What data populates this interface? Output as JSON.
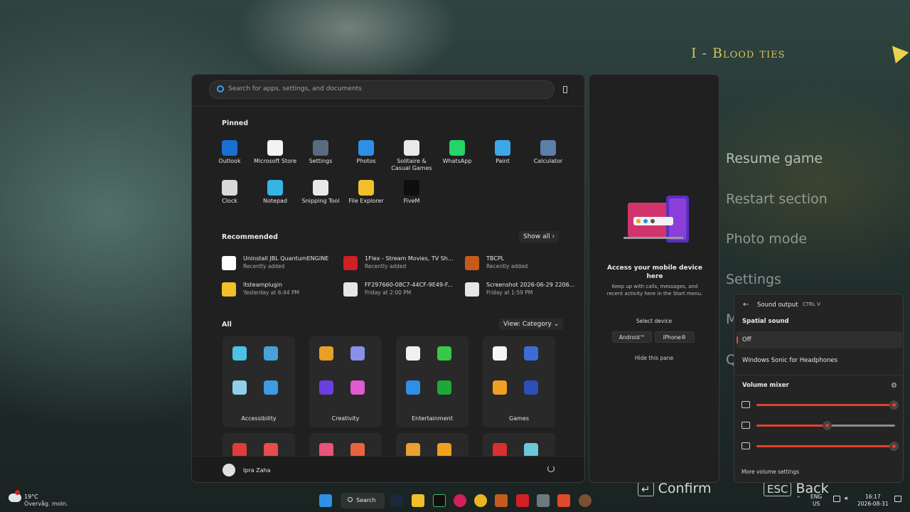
{
  "game": {
    "chapter_title": "I - Blood ties",
    "menu": [
      "Resume game",
      "Restart section",
      "Photo mode",
      "Settings",
      "M",
      "Q"
    ],
    "confirm_key": "↵",
    "confirm": "Confirm",
    "back_key": "ESC",
    "back": "Back"
  },
  "start": {
    "search_placeholder": "Search for apps, settings, and documents",
    "pinned_label": "Pinned",
    "pinned": [
      {
        "label": "Outlook",
        "icon": "outlook-icon",
        "color": "#1a6fd1"
      },
      {
        "label": "Microsoft Store",
        "icon": "store-icon",
        "color": "#f3f3f3"
      },
      {
        "label": "Settings",
        "icon": "settings-icon",
        "color": "#5a6a80"
      },
      {
        "label": "Photos",
        "icon": "photos-icon",
        "color": "#2f8fe6"
      },
      {
        "label": "Solitaire & Casual Games",
        "icon": "solitaire-icon",
        "color": "#e9e9e9"
      },
      {
        "label": "WhatsApp",
        "icon": "whatsapp-icon",
        "color": "#25d366"
      },
      {
        "label": "Paint",
        "icon": "paint-icon",
        "color": "#3ba7e8"
      },
      {
        "label": "Calculator",
        "icon": "calculator-icon",
        "color": "#5b7fa8"
      },
      {
        "label": "Clock",
        "icon": "clock-icon",
        "color": "#d9d9d9"
      },
      {
        "label": "Notepad",
        "icon": "notepad-icon",
        "color": "#35b5e6"
      },
      {
        "label": "Snipping Tool",
        "icon": "snipping-tool-icon",
        "color": "#e8e8e8"
      },
      {
        "label": "File Explorer",
        "icon": "folder-icon",
        "color": "#f2bf2a"
      },
      {
        "label": "FiveM",
        "icon": "fivem-icon",
        "color": "#0f0f0f"
      }
    ],
    "recommended_label": "Recommended",
    "show_all": "Show all  ›",
    "recommended": [
      {
        "title": "Uninstall JBL QuantumENGINE",
        "sub": "Recently added",
        "icon": "jbl-icon",
        "color": "#ffffff"
      },
      {
        "title": "1Flex - Stream Movies, TV Sh...",
        "sub": "Recently added",
        "icon": "1flex-icon",
        "color": "#d01f25"
      },
      {
        "title": "TBCPL",
        "sub": "Recently added",
        "icon": "tbcpl-icon",
        "color": "#c45b1d"
      },
      {
        "title": "ltsteamplugin",
        "sub": "Yesterday at 6:44 PM",
        "icon": "folder-icon",
        "color": "#f2bf2a"
      },
      {
        "title": "FF297660-08C7-44CF-9E49-F...",
        "sub": "Friday at 2:00 PM",
        "icon": "image-file-icon",
        "color": "#e6e6e6"
      },
      {
        "title": "Screenshot 2026-06-29 2206...",
        "sub": "Friday at 1:59 PM",
        "icon": "image-file-icon",
        "color": "#e6e6e6"
      }
    ],
    "all_label": "All",
    "view_label": "View: Category  ⌄",
    "categories": [
      {
        "name": "Accessibility",
        "colors": [
          "#4cc2e8",
          "#4aa0d8",
          "#8fd0e8",
          "#3d9be0"
        ]
      },
      {
        "name": "Creativity",
        "colors": [
          "#e8a028",
          "#8a8fe8",
          "#6a3fe0",
          "#e05ad0"
        ]
      },
      {
        "name": "Entertainment",
        "colors": [
          "#f0f0f0",
          "#37c84a",
          "#2f8fe6",
          "#1fa83a"
        ]
      },
      {
        "name": "Games",
        "colors": [
          "#f5f5f5",
          "#3d6bd6",
          "#f0a020",
          "#2c4fb8"
        ]
      },
      {
        "name": "",
        "colors": [
          "#e23b3b",
          "#e84b4b"
        ]
      },
      {
        "name": "",
        "colors": [
          "#e8557a",
          "#e8643f"
        ]
      },
      {
        "name": "",
        "colors": [
          "#e8a030",
          "#f0a020"
        ]
      },
      {
        "name": "",
        "colors": [
          "#d83030",
          "#6ac8d8"
        ]
      }
    ],
    "user_name": "Ipra Zaha"
  },
  "phone_pane": {
    "heading": "Access your mobile device here",
    "body": "Keep up with calls, messages, and recent activity here in the Start menu.",
    "select_label": "Select device",
    "android": "Android™",
    "iphone": "iPhone®",
    "hide": "Hide this pane"
  },
  "sound": {
    "back": "←",
    "title": "Sound output",
    "shortcut": "CTRL   V",
    "spatial_label": "Spatial sound",
    "off": "Off",
    "sonic": "Windows Sonic for Headphones",
    "mixer_label": "Volume mixer",
    "mixer": [
      {
        "icon": "monitor-icon",
        "value": 0.99
      },
      {
        "icon": "game-icon",
        "value": 0.51
      },
      {
        "icon": "steam-icon",
        "value": 0.99
      }
    ],
    "more": "More volume settings"
  },
  "taskbar": {
    "temp": "19°C",
    "condition": "Övervåg. moln.",
    "search": "Search",
    "lang_1": "ENG",
    "lang_2": "US",
    "time": "16:17",
    "date": "2026-08-31"
  }
}
